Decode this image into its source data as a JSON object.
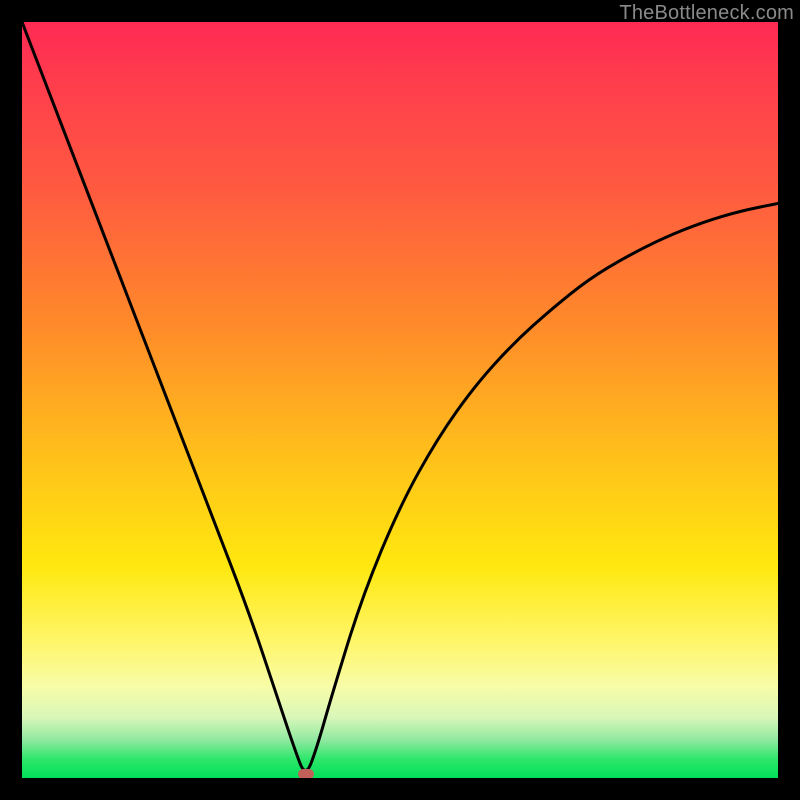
{
  "watermark": {
    "text": "TheBottleneck.com"
  },
  "chart_data": {
    "type": "line",
    "title": "",
    "xlabel": "",
    "ylabel": "",
    "xlim": [
      0,
      100
    ],
    "ylim": [
      0,
      100
    ],
    "grid": false,
    "series": [
      {
        "name": "bottleneck-curve",
        "x": [
          0,
          5,
          10,
          15,
          20,
          25,
          30,
          34,
          36,
          37.5,
          39,
          41,
          45,
          50,
          55,
          60,
          65,
          70,
          75,
          80,
          85,
          90,
          95,
          100
        ],
        "values": [
          100,
          87,
          74,
          61,
          48,
          35,
          22,
          10,
          4,
          0,
          4,
          11,
          24,
          36,
          45,
          52,
          57.5,
          62,
          66,
          69,
          71.5,
          73.5,
          75,
          76
        ]
      }
    ],
    "minimum_marker": {
      "x": 37.5,
      "y": 0
    },
    "colors": {
      "curve": "#000000",
      "marker": "#c06058",
      "gradient_top": "#ff2a54",
      "gradient_bottom": "#00e05a"
    }
  }
}
